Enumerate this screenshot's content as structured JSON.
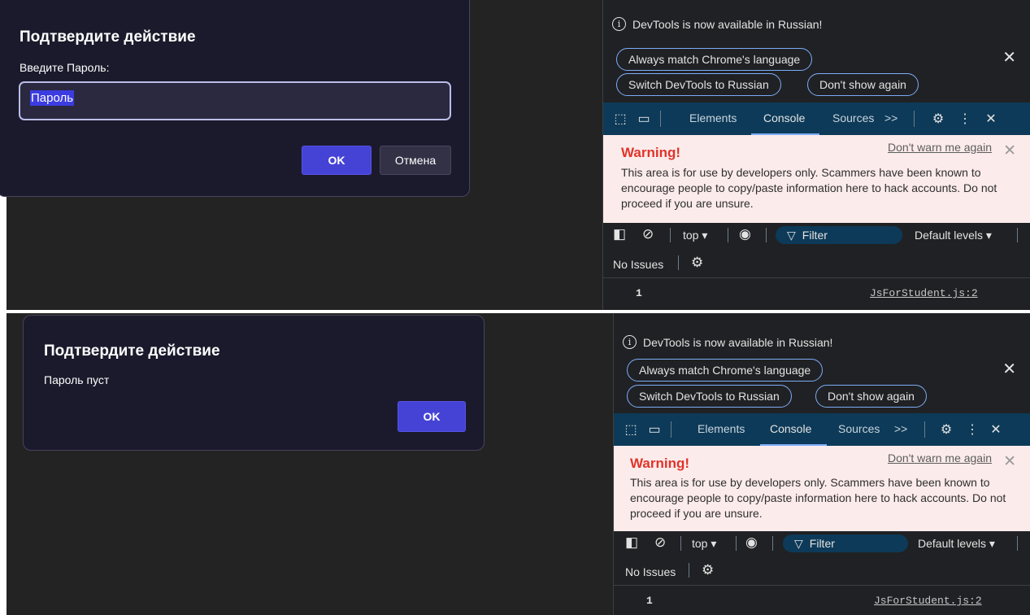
{
  "screens": [
    {
      "dialog": {
        "title": "Подтвердите действие",
        "message": "Введите Пароль:",
        "input_value": "Пароль",
        "ok_label": "OK",
        "cancel_label": "Отмена"
      }
    },
    {
      "dialog": {
        "title": "Подтвердите действие",
        "message": "Пароль пуст",
        "ok_label": "OK"
      }
    }
  ],
  "devtools": {
    "notice_text": "DevTools is now available in Russian!",
    "btn_match": "Always match Chrome's language",
    "btn_switch": "Switch DevTools to Russian",
    "btn_dont_show": "Don't show again",
    "tabs": [
      "Elements",
      "Console",
      "Sources"
    ],
    "more_tabs": ">>",
    "warning": {
      "title": "Warning!",
      "dismiss_link": "Don't warn me again",
      "body": "This area is for use by developers only. Scammers have been known to encourage people to copy/paste information here to hack accounts. Do not proceed if you are unsure."
    },
    "context": "top",
    "filter_placeholder": "Filter",
    "levels": "Default levels",
    "issues": "No Issues",
    "console_line": {
      "value": "1",
      "source": "JsForStudent.js:2"
    }
  },
  "colors": {
    "accent_button": "#4543d6",
    "dialog_bg": "#1b1a2c",
    "devtools_tabbar": "#0d3a58",
    "warning_bg": "#fcebeb",
    "warning_title": "#e0342a"
  }
}
